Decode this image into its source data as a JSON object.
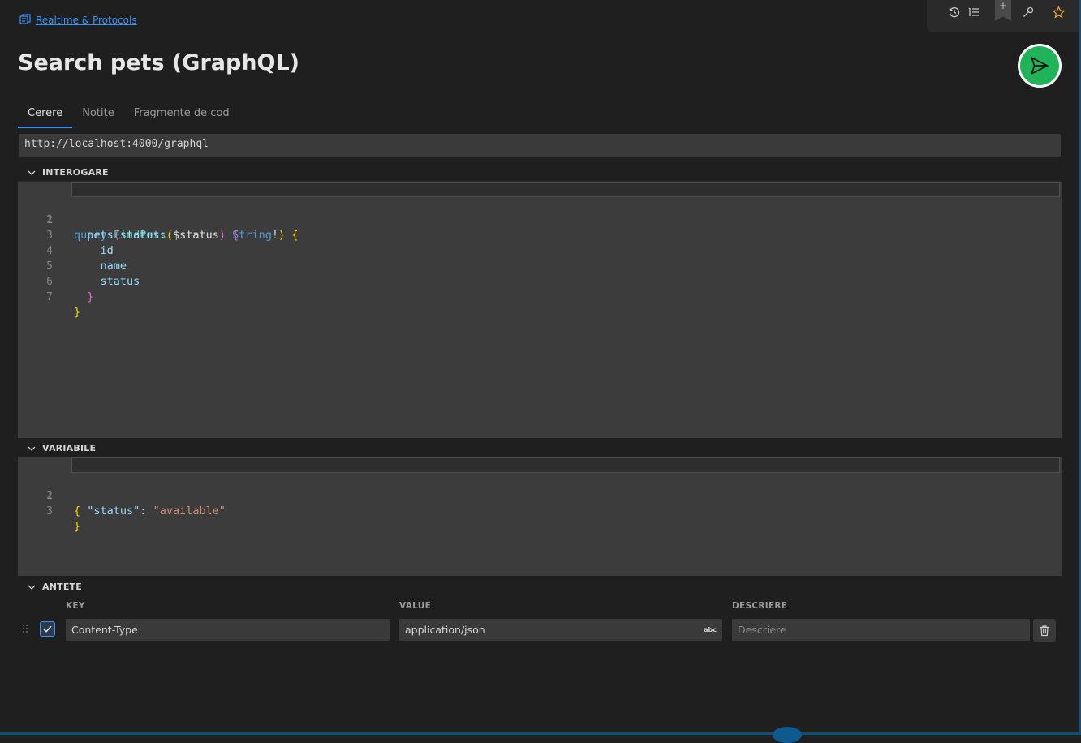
{
  "breadcrumb": {
    "icon": "collection-icon",
    "label": "Realtime & Protocols"
  },
  "title": "Search pets (GraphQL)",
  "toolbar": {
    "icons": [
      "history-icon",
      "list-icon",
      "bookmark-add-icon",
      "wrench-icon",
      "star-icon"
    ],
    "bookmark_symbol": "+"
  },
  "send": {
    "icon": "send-icon",
    "color": "#21b35a"
  },
  "tabs": [
    {
      "label": "Cerere",
      "active": true
    },
    {
      "label": "Notițe",
      "active": false
    },
    {
      "label": "Fragmente de cod",
      "active": false
    }
  ],
  "url": "http://localhost:4000/graphql",
  "sections": {
    "query": "INTEROGARE",
    "variables": "VARIABILE",
    "headers": "ANTETE"
  },
  "query_lines": [
    {
      "num": "1",
      "text": "query FindPets($status: String!) {"
    },
    {
      "num": "2",
      "text": "  pets(status: $status) {"
    },
    {
      "num": "3",
      "text": "    id"
    },
    {
      "num": "4",
      "text": "    name"
    },
    {
      "num": "5",
      "text": "    status"
    },
    {
      "num": "6",
      "text": "  }"
    },
    {
      "num": "7",
      "text": "}"
    }
  ],
  "variable_lines": [
    {
      "num": "1",
      "text": "{"
    },
    {
      "num": "2",
      "text": "  \"status\": \"available\""
    },
    {
      "num": "3",
      "text": "}"
    }
  ],
  "headers_table": {
    "columns": {
      "key": "KEY",
      "value": "VALUE",
      "description": "DESCRIERE"
    },
    "rows": [
      {
        "enabled": true,
        "key": "Content-Type",
        "value": "application/json",
        "value_type": "abc",
        "description_placeholder": "Descriere"
      }
    ]
  },
  "colors": {
    "accent": "#3794ff",
    "background": "#1f1f1f",
    "editor": "#3c3c3c",
    "star": "#e8a33a"
  }
}
